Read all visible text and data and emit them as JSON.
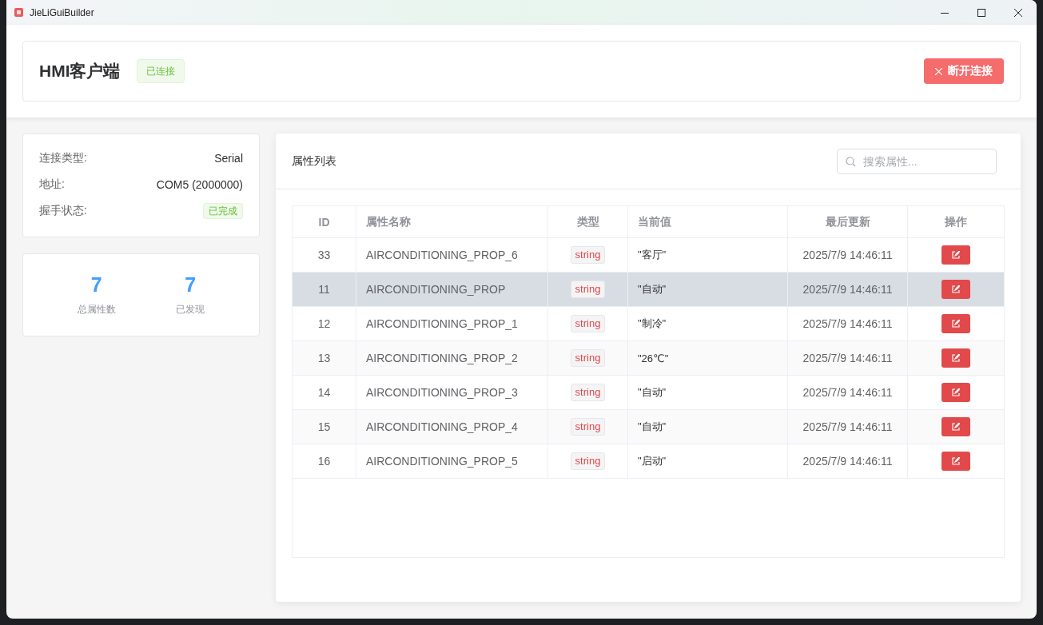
{
  "window": {
    "title": "JieLiGuiBuilder"
  },
  "header": {
    "title": "HMI客户端",
    "status_tag": "已连接",
    "disconnect_button": "断开连接"
  },
  "connection_info": [
    {
      "label": "连接类型:",
      "value": "Serial",
      "kind": "text"
    },
    {
      "label": "地址:",
      "value": "COM5 (2000000)",
      "kind": "text"
    },
    {
      "label": "握手状态:",
      "value": "已完成",
      "kind": "tag"
    }
  ],
  "stats": [
    {
      "value": "7",
      "label": "总属性数"
    },
    {
      "value": "7",
      "label": "已发现"
    }
  ],
  "property_list": {
    "title": "属性列表",
    "search": {
      "placeholder": "搜索属性..."
    },
    "columns": [
      "ID",
      "属性名称",
      "类型",
      "当前值",
      "最后更新",
      "操作"
    ],
    "rows": [
      {
        "id": "33",
        "name": "AIRCONDITIONING_PROP_6",
        "type": "string",
        "value": "\"客厅\"",
        "updated": "2025/7/9 14:46:11",
        "selected": false
      },
      {
        "id": "11",
        "name": "AIRCONDITIONING_PROP",
        "type": "string",
        "value": "\"自动\"",
        "updated": "2025/7/9 14:46:11",
        "selected": true
      },
      {
        "id": "12",
        "name": "AIRCONDITIONING_PROP_1",
        "type": "string",
        "value": "\"制冷\"",
        "updated": "2025/7/9 14:46:11",
        "selected": false
      },
      {
        "id": "13",
        "name": "AIRCONDITIONING_PROP_2",
        "type": "string",
        "value": "\"26℃\"",
        "updated": "2025/7/9 14:46:11",
        "selected": false
      },
      {
        "id": "14",
        "name": "AIRCONDITIONING_PROP_3",
        "type": "string",
        "value": "\"自动\"",
        "updated": "2025/7/9 14:46:11",
        "selected": false
      },
      {
        "id": "15",
        "name": "AIRCONDITIONING_PROP_4",
        "type": "string",
        "value": "\"自动\"",
        "updated": "2025/7/9 14:46:11",
        "selected": false
      },
      {
        "id": "16",
        "name": "AIRCONDITIONING_PROP_5",
        "type": "string",
        "value": "\"启动\"",
        "updated": "2025/7/9 14:46:11",
        "selected": false
      }
    ]
  }
}
